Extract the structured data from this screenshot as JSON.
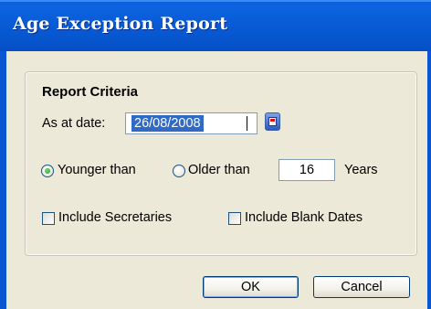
{
  "window": {
    "title": "Age Exception Report"
  },
  "criteria": {
    "group_title": "Report Criteria",
    "as_at_label": "As at date:",
    "as_at_value": "26/08/2008",
    "younger_label": "Younger than",
    "older_label": "Older than",
    "selected_option": "Younger than",
    "years_value": "16",
    "years_label": "Years",
    "include_secretaries_label": "Include Secretaries",
    "include_secretaries_checked": false,
    "include_blank_dates_label": "Include Blank Dates",
    "include_blank_dates_checked": false
  },
  "buttons": {
    "ok": "OK",
    "cancel": "Cancel"
  },
  "icons": {
    "calendar": "calendar-icon"
  },
  "colors": {
    "titlebar": "#0a5fd8",
    "dialog_bg": "#ece9d8",
    "selection": "#316ac5"
  }
}
